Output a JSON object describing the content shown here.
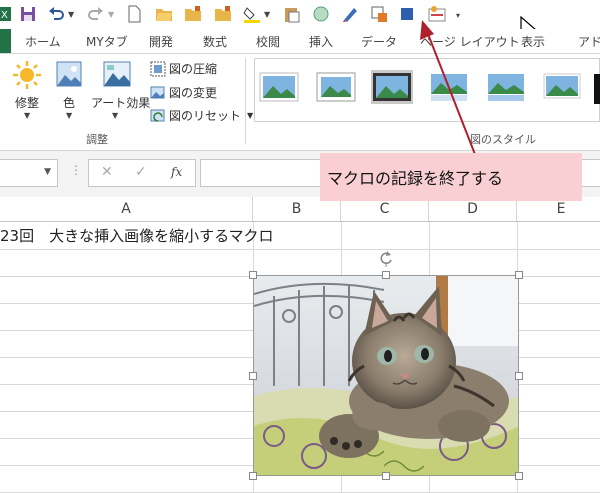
{
  "quick_access": {
    "icons": [
      "excel-icon",
      "save-icon",
      "undo-icon",
      "redo-icon",
      "new-file-icon",
      "open-folder-icon",
      "folder-icon",
      "folder-icon",
      "fill-color-icon",
      "paste-icon",
      "circle-icon",
      "pen-icon",
      "export-icon",
      "stop-recording-icon",
      "gallery-icon",
      "customize-icon"
    ]
  },
  "ribbon_tabs": [
    "ホーム",
    "MYタブ",
    "開発",
    "数式",
    "校閲",
    "挿入",
    "データ",
    "ページ レイアウト",
    "表示",
    "アドイ"
  ],
  "ribbon": {
    "adjust_group": {
      "correct_label": "修整",
      "color_label": "色",
      "art_effect_label": "アート効果",
      "compress_label": "図の圧縮",
      "change_label": "図の変更",
      "reset_label": "図のリセット",
      "group_label": "調整"
    },
    "styles_group": {
      "group_label": "図のスタイル"
    }
  },
  "formula_bar": {
    "cancel_symbol": "✕",
    "enter_symbol": "✓",
    "fx_symbol": "fx",
    "formula_value": ""
  },
  "columns": [
    "A",
    "B",
    "C",
    "D",
    "E"
  ],
  "cells": {
    "A1": "23回　大きな挿入画像を縮小するマクロ"
  },
  "callout": {
    "text": "マクロの記録を終了する"
  },
  "colors": {
    "excel_green": "#217346",
    "callout_bg": "#f9cfd3",
    "arrow": "#b0202a",
    "stop_button": "#2e5fae"
  }
}
